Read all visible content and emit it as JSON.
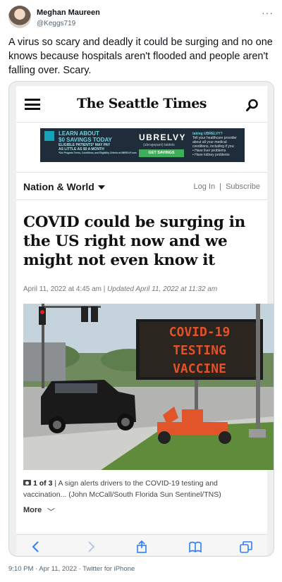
{
  "tweet": {
    "display_name": "Meghan Maureen",
    "handle": "@Keggs719",
    "text": "A virus so scary and deadly it could be surging and no one knows because hospitals aren't flooded and people aren't falling over. Scary.",
    "footer": "9:10 PM · Apr 11, 2022 · Twitter for iPhone"
  },
  "article": {
    "masthead": "The Seattle Times",
    "section": "Nation & World",
    "login": "Log In",
    "subscribe": "Subscribe",
    "link_separator": "|",
    "headline": "COVID could be surging in the US right now and we might not even know it",
    "date": "April 11, 2022 at 4:45 am",
    "updated": "Updated April 11, 2022 at 11:32 am",
    "caption_count": "1 of 3",
    "caption": "A sign alerts drivers to the COVID-19 testing and vaccination... (John McCall/South Florida Sun Sentinel/TNS)",
    "more": "More"
  },
  "ad": {
    "left_title1": "LEARN ABOUT",
    "left_title2": "$0 SAVINGS TODAY",
    "left_small1": "ELIGIBLE PATIENTS* MAY PAY",
    "left_small2": "AS LITTLE AS $0 A MONTH",
    "left_fine": "*See Program Terms, Conditions, and Eligibility Criteria at UBRELVY.com",
    "brand": "UBRELVY",
    "brand_sub": "(ubrogepant) tablets",
    "button": "GET SAVINGS",
    "right_title": "taking UBRELVY?",
    "right_text": "Tell your healthcare provider about all your medical conditions, including if you:",
    "right_b1": "• Have liver problems",
    "right_b2": "• Have kidney problems"
  },
  "photo": {
    "sign_line1": "COVID-19",
    "sign_line2": "TESTING",
    "sign_line3": "VACCINE"
  },
  "colors": {
    "twitter_grey": "#536471",
    "sign_led": "#e0522a",
    "trailer_orange": "#e2542a"
  }
}
